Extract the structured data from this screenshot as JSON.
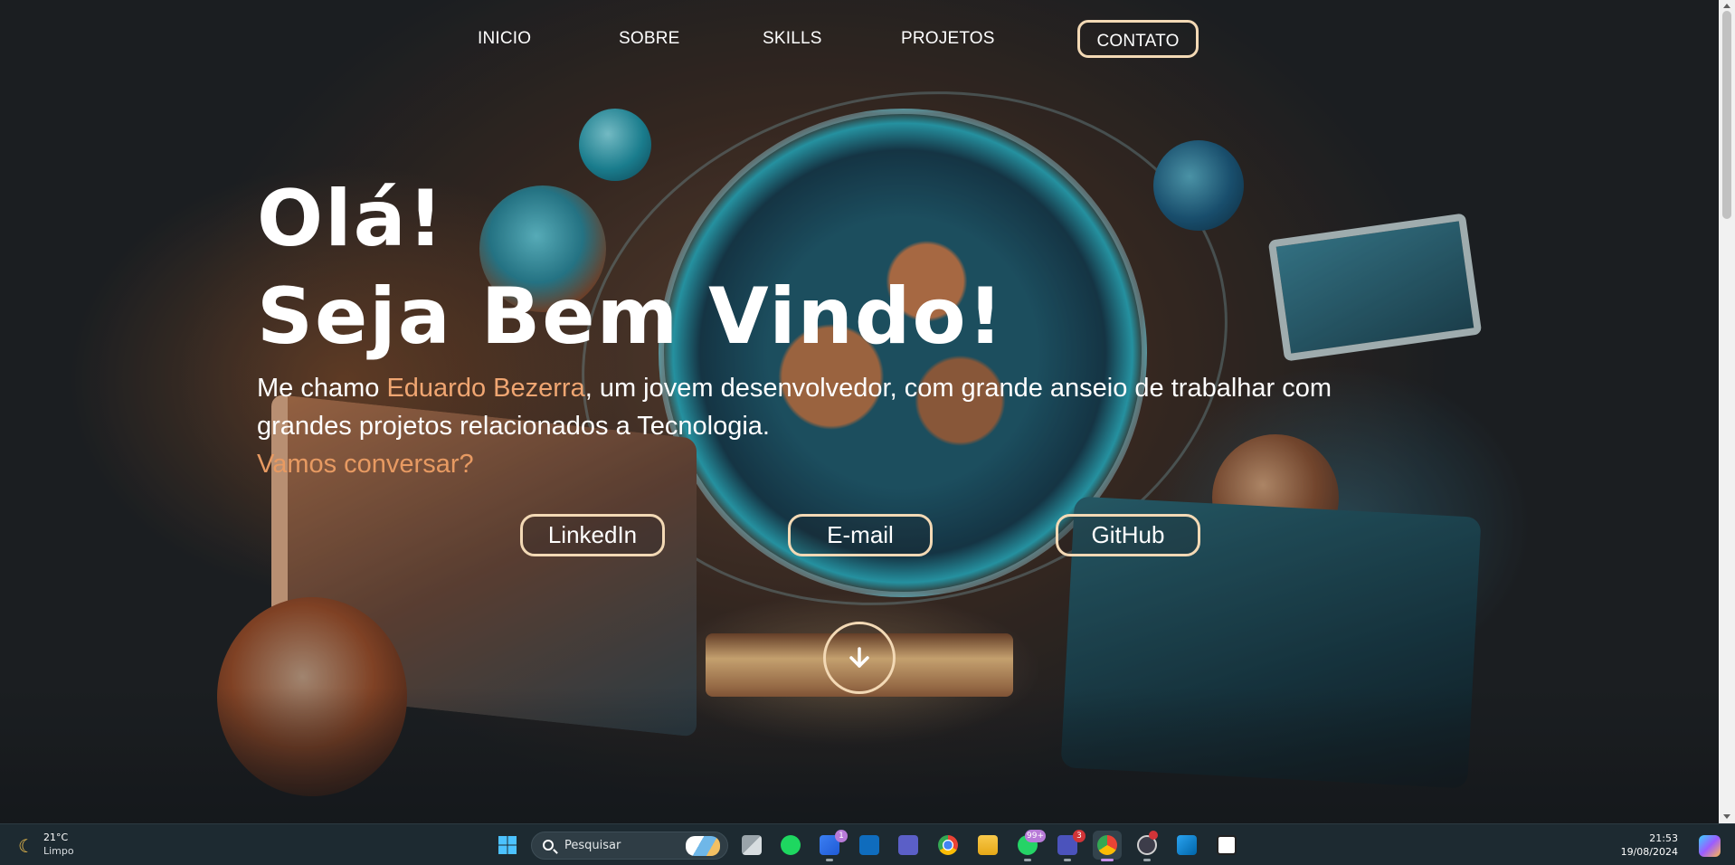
{
  "nav": {
    "items": [
      {
        "label": "INICIO"
      },
      {
        "label": "SOBRE"
      },
      {
        "label": "SKILLS"
      },
      {
        "label": "PROJETOS"
      },
      {
        "label": "CONTATO"
      }
    ]
  },
  "hero": {
    "greeting": "Olá!",
    "welcome": "Seja Bem Vindo!",
    "intro_prefix": "Me chamo ",
    "name": "Eduardo Bezerra",
    "intro_suffix": ", um jovem desenvolvedor, com grande anseio de trabalhar com grandes projetos relacionados a Tecnologia.",
    "cta": "Vamos conversar?",
    "buttons": [
      {
        "label": "LinkedIn"
      },
      {
        "label": "E-mail"
      },
      {
        "label": "GitHub"
      }
    ],
    "scroll_icon": "arrow-down-icon"
  },
  "colors": {
    "accent": "#f0a672",
    "button_border": "#f3d9b5",
    "taskbar": "#1d2a31"
  },
  "taskbar": {
    "weather": {
      "temp": "21°C",
      "condition": "Limpo",
      "icon": "moon-icon"
    },
    "search_placeholder": "Pesquisar",
    "apps": [
      {
        "name": "windows-start-icon"
      },
      {
        "name": "task-view-icon"
      },
      {
        "name": "spotify-icon"
      },
      {
        "name": "todo-icon",
        "badge": "1"
      },
      {
        "name": "outlook-icon"
      },
      {
        "name": "teams-icon"
      },
      {
        "name": "chrome-icon"
      },
      {
        "name": "file-explorer-icon"
      },
      {
        "name": "whatsapp-icon",
        "badge": "99+"
      },
      {
        "name": "teams-work-icon",
        "badge": "3"
      },
      {
        "name": "chrome-profile-icon"
      },
      {
        "name": "github-desktop-icon"
      },
      {
        "name": "vscode-icon"
      },
      {
        "name": "notion-icon"
      }
    ],
    "time": "21:53",
    "date": "19/08/2024"
  }
}
